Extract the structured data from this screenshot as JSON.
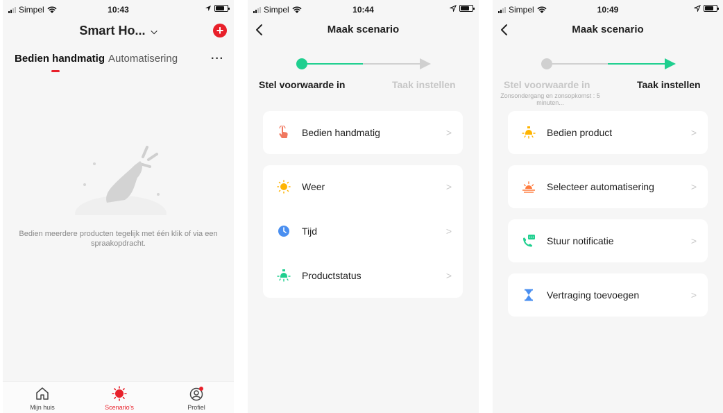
{
  "screen1": {
    "status": {
      "carrier": "Simpel",
      "time": "10:43"
    },
    "title": "Smart Ho...",
    "title_chevron": "chevron-down-icon",
    "tabs": [
      {
        "label": "Bedien handmatig"
      },
      {
        "label": "Automatisering"
      }
    ],
    "more_label": "···",
    "empty_text": "Bedien meerdere producten tegelijk met één klik of via een spraakopdracht.",
    "tabbar": [
      {
        "label": "Mijn huis",
        "icon": "home-icon"
      },
      {
        "label": "Scenario's",
        "icon": "sun-icon"
      },
      {
        "label": "Profiel",
        "icon": "profile-icon"
      }
    ],
    "accent": "#e8202a"
  },
  "screen2": {
    "status": {
      "carrier": "Simpel",
      "time": "10:44"
    },
    "title": "Maak scenario",
    "steps": [
      {
        "label": "Stel voorwaarde in",
        "active": true
      },
      {
        "label": "Taak instellen",
        "active": false
      }
    ],
    "card1": [
      {
        "label": "Bedien handmatig",
        "icon": "tap-hand-icon"
      }
    ],
    "card2": [
      {
        "label": "Weer",
        "icon": "sun-icon"
      },
      {
        "label": "Tijd",
        "icon": "clock-icon"
      },
      {
        "label": "Productstatus",
        "icon": "bulb-icon"
      }
    ],
    "accent": "#1fcf8f"
  },
  "screen3": {
    "status": {
      "carrier": "Simpel",
      "time": "10:49"
    },
    "title": "Maak scenario",
    "steps": [
      {
        "label": "Stel voorwaarde in",
        "sub": "Zonsondergang en zonsopkomst : 5 minuten...",
        "active": false
      },
      {
        "label": "Taak instellen",
        "active": true
      }
    ],
    "rows": [
      {
        "label": "Bedien product",
        "icon": "bulb-icon"
      },
      {
        "label": "Selecteer automatisering",
        "icon": "sunrise-icon"
      },
      {
        "label": "Stuur notificatie",
        "icon": "notification-phone-icon"
      },
      {
        "label": "Vertraging toevoegen",
        "icon": "hourglass-icon"
      }
    ]
  }
}
